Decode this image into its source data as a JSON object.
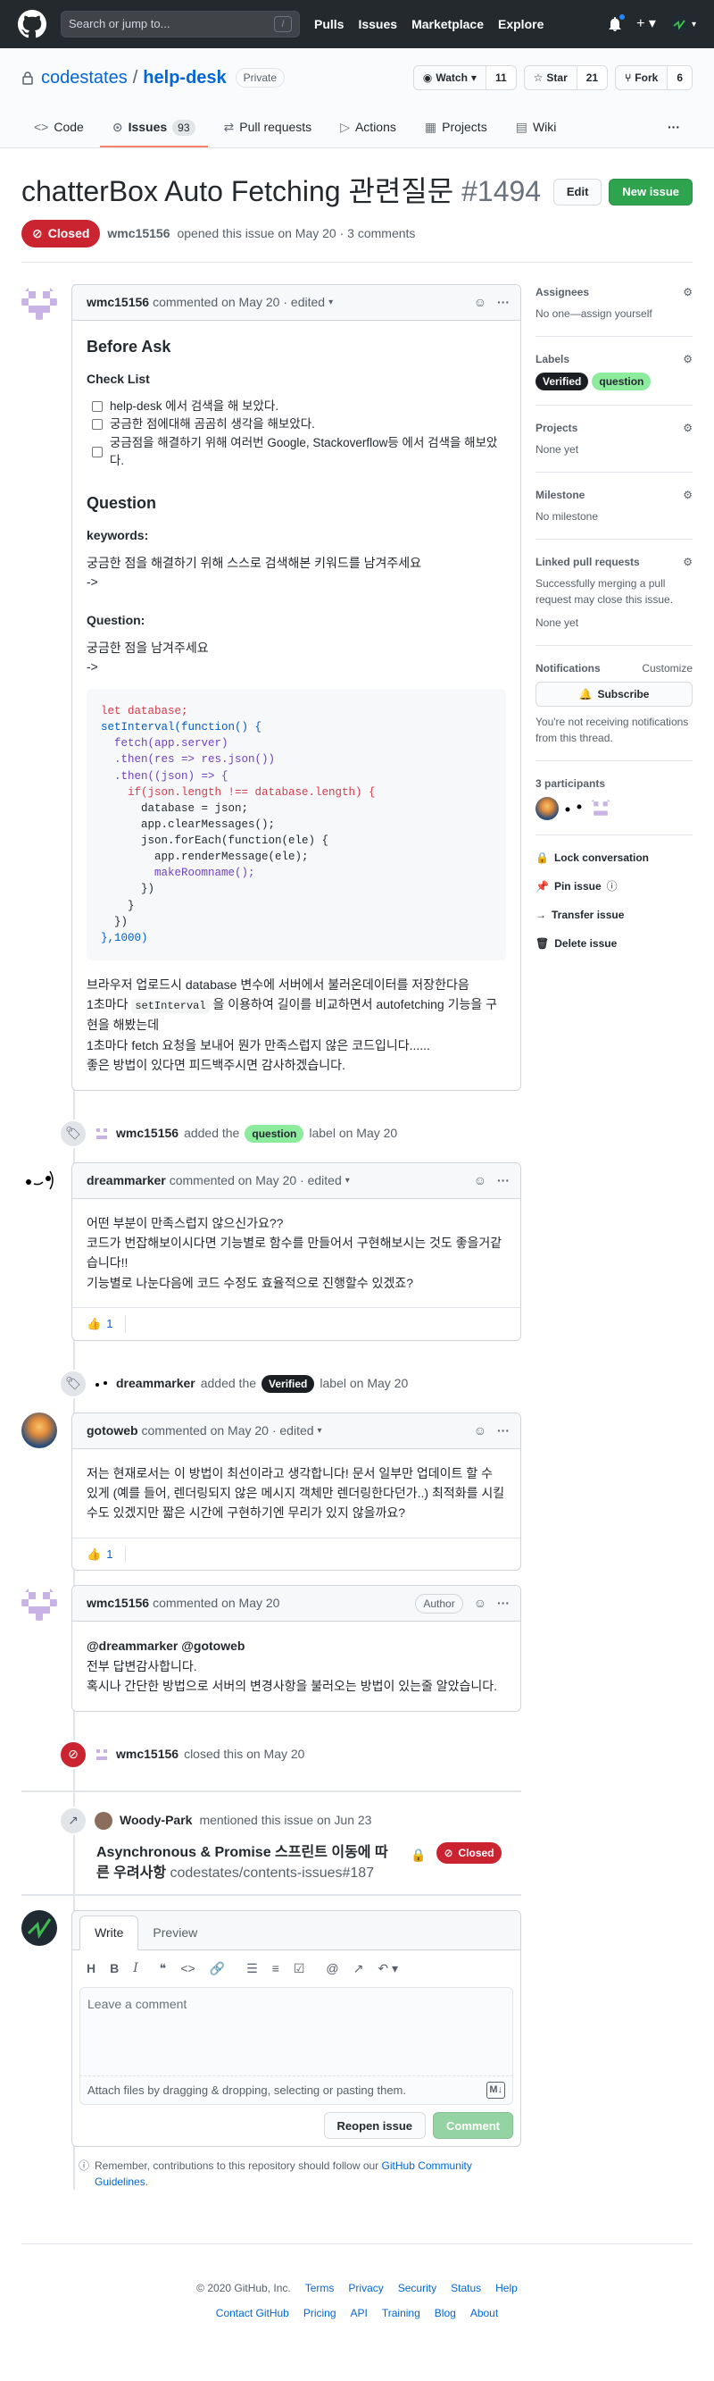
{
  "header": {
    "search_placeholder": "Search or jump to...",
    "search_key": "/",
    "nav": [
      "Pulls",
      "Issues",
      "Marketplace",
      "Explore"
    ]
  },
  "repo": {
    "owner": "codestates",
    "separator": "/",
    "name": "help-desk",
    "visibility": "Private",
    "watch_label": "Watch",
    "watch_count": "11",
    "star_label": "Star",
    "star_count": "21",
    "fork_label": "Fork",
    "fork_count": "6",
    "tabs": [
      {
        "label": "Code"
      },
      {
        "label": "Issues",
        "count": "93"
      },
      {
        "label": "Pull requests"
      },
      {
        "label": "Actions"
      },
      {
        "label": "Projects"
      },
      {
        "label": "Wiki"
      }
    ],
    "more": "···"
  },
  "issue": {
    "title": "chatterBox Auto Fetching 관련질문",
    "number": "#1494",
    "edit_label": "Edit",
    "new_issue_label": "New issue",
    "state": "Closed",
    "author": "wmc15156",
    "meta_text": "opened this issue on May 20 · 3 comments"
  },
  "comments": {
    "c1": {
      "author": "wmc15156",
      "meta": "commented on May 20 · edited",
      "before_ask": "Before Ask",
      "checklist_title": "Check List",
      "tasks": [
        "help-desk 에서 검색을 해 보았다.",
        "궁금한 점에대해 곰곰히 생각을 해보았다.",
        "궁금점을 해결하기 위해 여러번 Google, Stackoverflow등 에서 검색을 해보았다."
      ],
      "question_h": "Question",
      "keywords_h": "keywords:",
      "keywords_text": "궁금한 점을 해결하기 위해 스스로 검색해본 키워드를 남겨주세요",
      "arrow": "->",
      "question_label": "Question:",
      "question_text": "궁금한 점을 남겨주세요",
      "code": [
        "let database;",
        "setInterval(function() {",
        "  fetch(app.server)",
        "  .then(res => res.json())",
        "  .then((json) => {",
        "    if(json.length !== database.length) {",
        "      database = json;",
        "      app.clearMessages();",
        "      json.forEach(function(ele) {",
        "        app.renderMessage(ele);",
        "        makeRoomname();",
        "      })",
        "    }",
        "  })",
        "},1000)"
      ],
      "para1": "브라우저 업로드시 database 변수에 서버에서 불러온데이터를 저장한다음",
      "para2_pre": "1초마다",
      "para2_code": "setInterval",
      "para2_post": "을 이용하여 길이를 비교하면서 autofetching 기능을 구현을 해봤는데",
      "para3": "1초마다 fetch 요청을 보내어 뭔가 만족스럽지 않은 코드입니다......",
      "para4": "좋은 방법이 있다면 피드백주시면 감사하겠습니다."
    },
    "ev1": {
      "actor": "wmc15156",
      "pre": "added the",
      "label": "question",
      "post": "label on May 20"
    },
    "c2": {
      "author": "dreammarker",
      "meta": "commented on May 20 · edited",
      "lines": [
        "어떤 부분이 만족스럽지 않으신가요??",
        "코드가 번잡해보이시다면 기능별로 함수를 만들어서 구현해보시는 것도 좋을거같습니다!!",
        "기능별로 나눈다음에 코드 수정도 효율적으로 진행할수 있겠죠?"
      ],
      "reaction_count": "1"
    },
    "ev2": {
      "actor": "dreammarker",
      "pre": "added the",
      "label": "Verified",
      "post": "label on May 20"
    },
    "c3": {
      "author": "gotoweb",
      "meta": "commented on May 20 · edited",
      "lines": [
        "저는 현재로서는 이 방법이 최선이라고 생각합니다! 문서 일부만 업데이트 할 수 있게 (예를 들어, 렌더링되지 않은 메시지 객체만 렌더링한다던가..) 최적화를 시킬 수도 있겠지만 짧은 시간에 구현하기엔 무리가 있지 않을까요?"
      ],
      "reaction_count": "1"
    },
    "c4": {
      "author": "wmc15156",
      "meta": "commented on May 20",
      "badge": "Author",
      "mention": "@dreammarker @gotoweb",
      "lines": [
        "전부 답변감사합니다.",
        "혹시나 간단한 방법으로 서버의 변경사항을 불러오는 방법이 있는줄 알았습니다."
      ]
    },
    "ev3": {
      "actor": "wmc15156",
      "text": "closed this on May 20"
    },
    "xref": {
      "actor": "Woody-Park",
      "text": "mentioned this issue on Jun 23",
      "title": "Asynchronous & Promise 스프린트 이동에 따른 우려사항",
      "ref": "codestates/contents-issues#187",
      "state": "Closed"
    }
  },
  "composer": {
    "tab_write": "Write",
    "tab_preview": "Preview",
    "placeholder": "Leave a comment",
    "attach_text": "Attach files by dragging & dropping, selecting or pasting them.",
    "reopen_label": "Reopen issue",
    "comment_label": "Comment",
    "tip_pre": "Remember, contributions to this repository should follow our",
    "tip_link": "GitHub Community Guidelines",
    "tip_post": "."
  },
  "sidebar": {
    "assignees_h": "Assignees",
    "assignees_v": "No one—assign yourself",
    "labels_h": "Labels",
    "labels": [
      {
        "name": "Verified"
      },
      {
        "name": "question"
      }
    ],
    "projects_h": "Projects",
    "projects_v": "None yet",
    "milestone_h": "Milestone",
    "milestone_v": "No milestone",
    "linked_h": "Linked pull requests",
    "linked_note": "Successfully merging a pull request may close this issue.",
    "linked_v": "None yet",
    "notifications_h": "Notifications",
    "customize": "Customize",
    "subscribe": "Subscribe",
    "notif_note": "You're not receiving notifications from this thread.",
    "participants_h": "3 participants",
    "actions": [
      "Lock conversation",
      "Pin issue",
      "Transfer issue",
      "Delete issue"
    ]
  },
  "footer": {
    "copyright": "© 2020 GitHub, Inc.",
    "row1": [
      "Terms",
      "Privacy",
      "Security",
      "Status",
      "Help"
    ],
    "row2": [
      "Contact GitHub",
      "Pricing",
      "API",
      "Training",
      "Blog",
      "About"
    ]
  },
  "colors": {
    "closed": "#cb2431",
    "green": "#2ea44f",
    "link": "#0366d6",
    "question_label": "#8deb9e",
    "verified_label": "#1b1f23"
  }
}
